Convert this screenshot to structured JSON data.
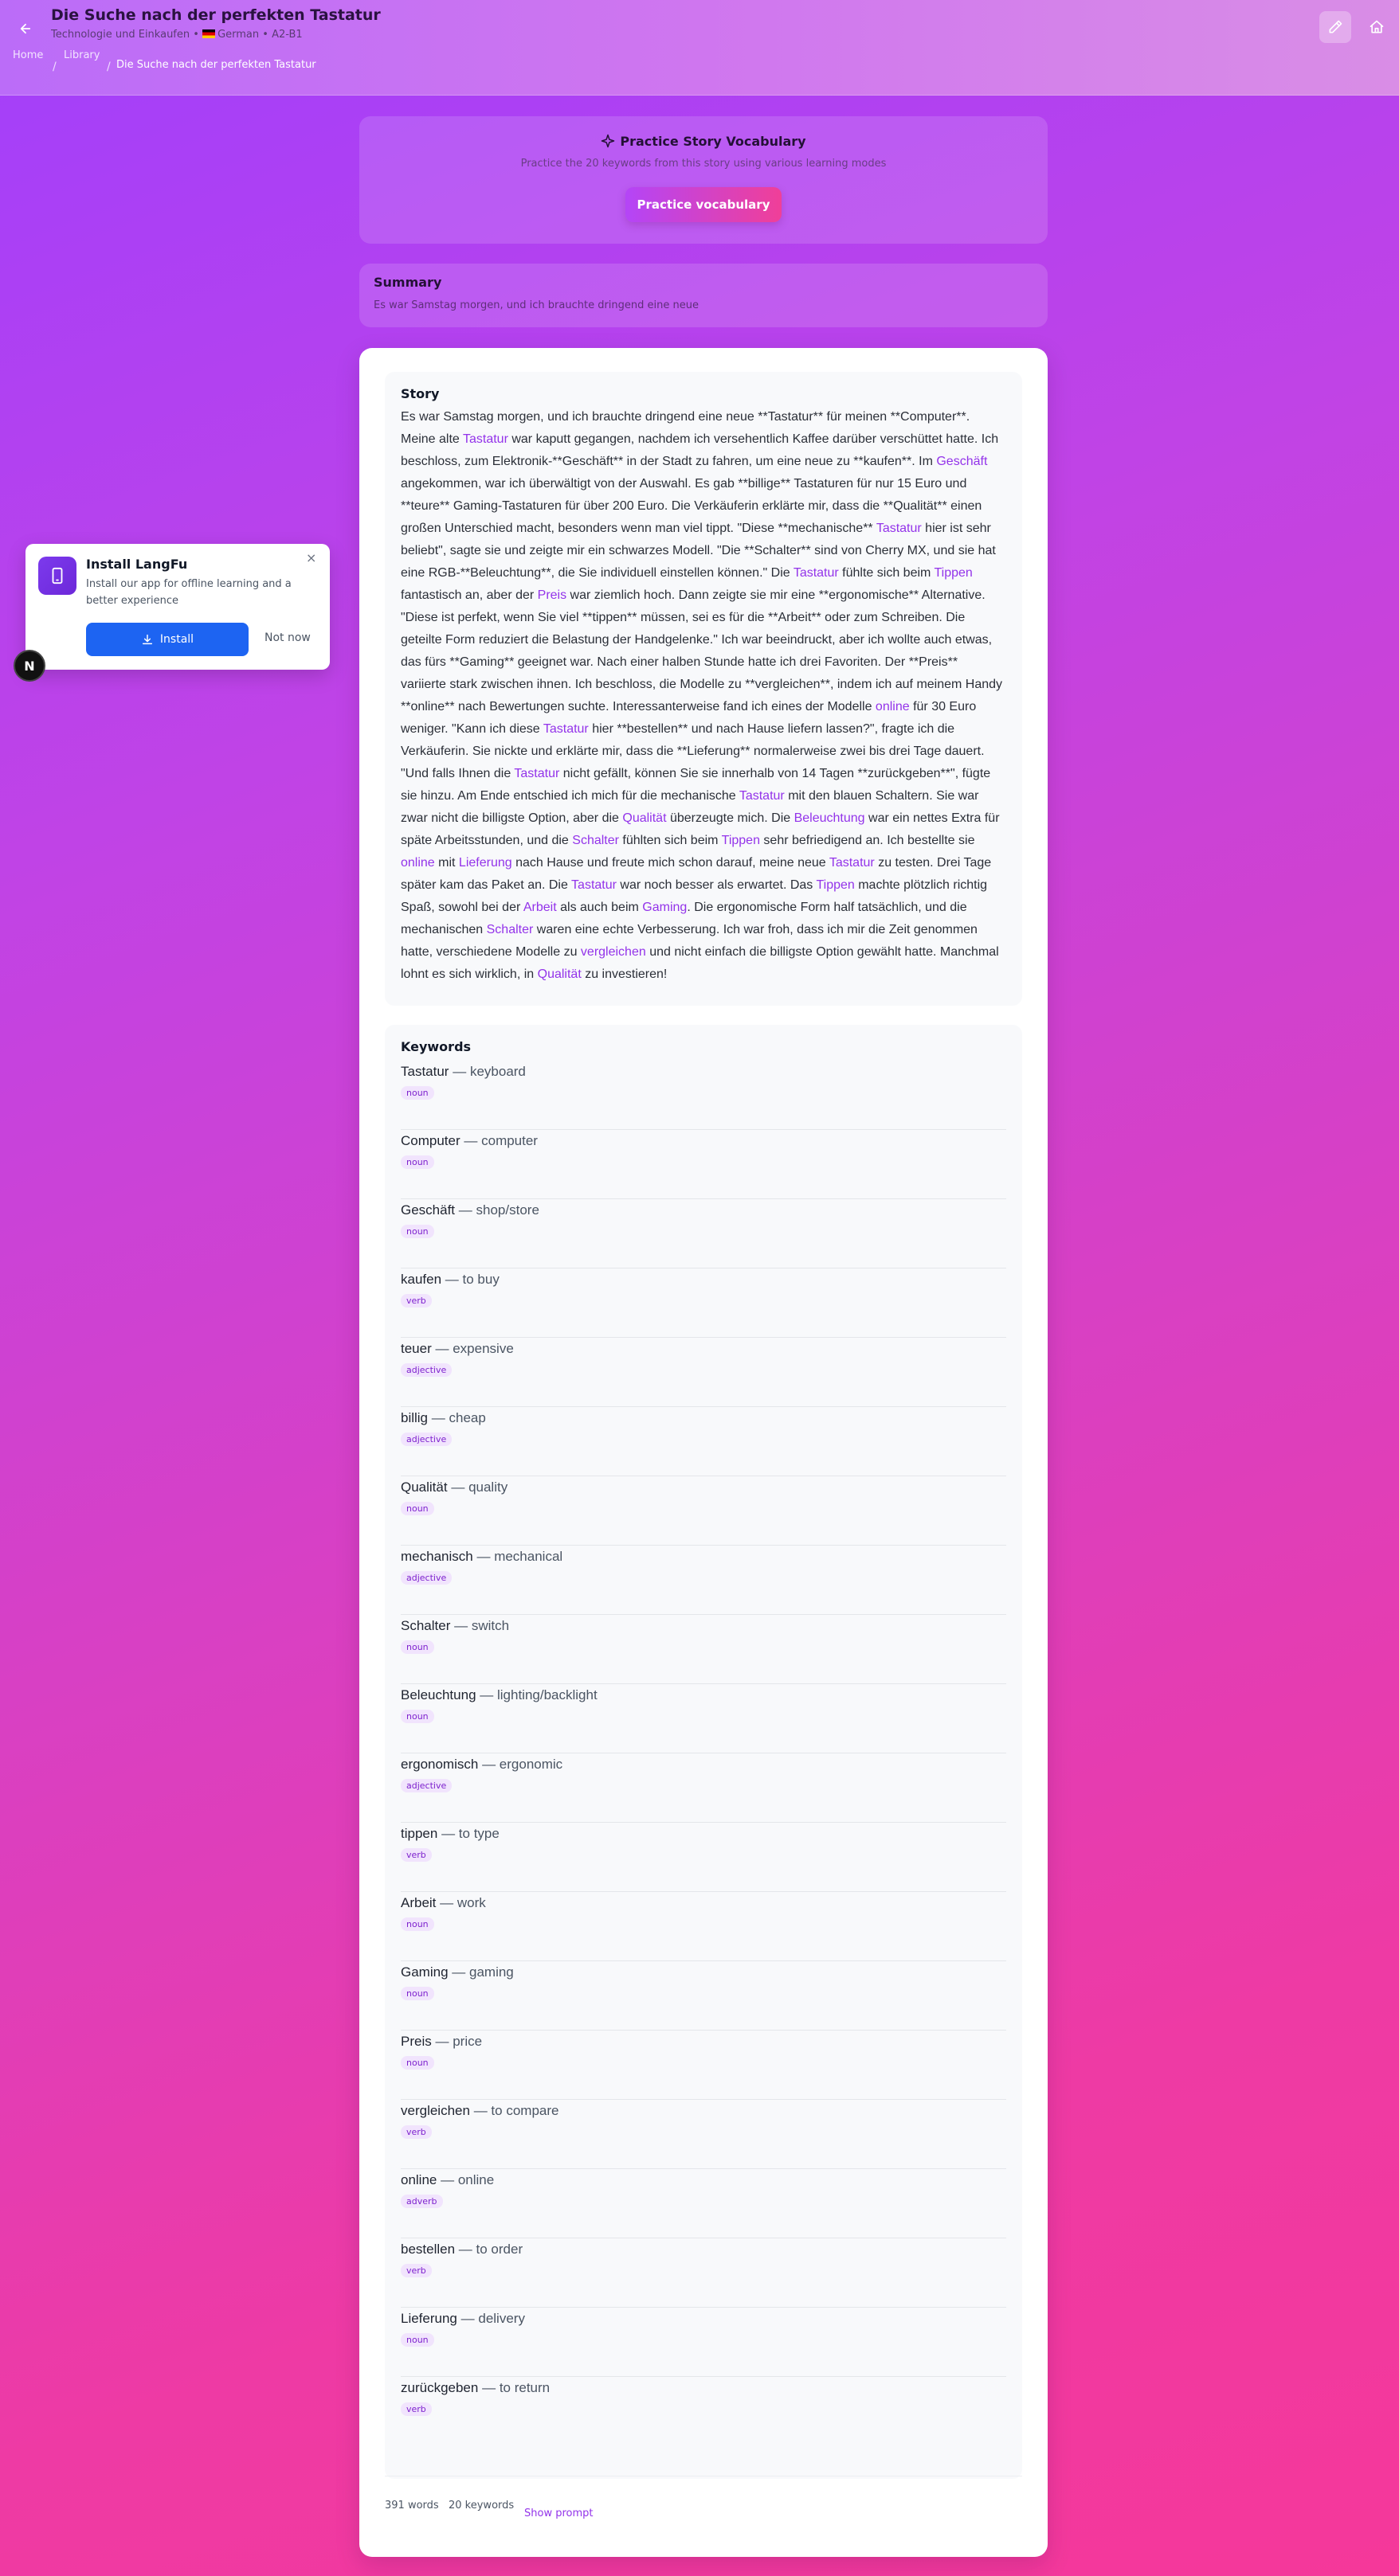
{
  "header": {
    "title": "Die Suche nach der perfekten Tastatur",
    "subtitle_category": "Technologie und Einkaufen",
    "subtitle_language": "German",
    "subtitle_level": "A2-B1",
    "subtitle_sep": "•",
    "breadcrumbs": [
      "Home",
      "Library",
      "Die Suche nach der perfekten Tastatur"
    ],
    "crumb_sep": "/"
  },
  "practice": {
    "title": "Practice Story Vocabulary",
    "description": "Practice the 20 keywords from this story using various learning modes",
    "button": "Practice vocabulary"
  },
  "summary": {
    "title": "Summary",
    "text": "Es war Samstag morgen, und ich brauchte dringend eine neue"
  },
  "story": {
    "title": "Story",
    "segments": [
      {
        "t": "Es war Samstag morgen, und ich brauchte dringend eine neue **Tastatur** für meinen **Computer**. Meine alte "
      },
      {
        "t": "Tastatur",
        "k": true
      },
      {
        "t": " war kaputt gegangen, nachdem ich versehentlich Kaffee darüber verschüttet hatte. Ich beschloss, zum Elektronik-**Geschäft** in der Stadt zu fahren, um eine neue zu **kaufen**. Im "
      },
      {
        "t": "Geschäft",
        "k": true
      },
      {
        "t": " angekommen, war ich überwältigt von der Auswahl. Es gab **billige** Tastaturen für nur 15 Euro und **teure** Gaming-Tastaturen für über 200 Euro. Die Verkäuferin erklärte mir, dass die **Qualität** einen großen Unterschied macht, besonders wenn man viel tippt. \"Diese **mechanische** "
      },
      {
        "t": "Tastatur",
        "k": true
      },
      {
        "t": " hier ist sehr beliebt\", sagte sie und zeigte mir ein schwarzes Modell. \"Die **Schalter** sind von Cherry MX, und sie hat eine RGB-**Beleuchtung**, die Sie individuell einstellen können.\" Die "
      },
      {
        "t": "Tastatur",
        "k": true
      },
      {
        "t": " fühlte sich beim "
      },
      {
        "t": "Tippen",
        "k": true
      },
      {
        "t": " fantastisch an, aber der "
      },
      {
        "t": "Preis",
        "k": true
      },
      {
        "t": " war ziemlich hoch. Dann zeigte sie mir eine **ergonomische** Alternative. \"Diese ist perfekt, wenn Sie viel **tippen** müssen, sei es für die **Arbeit** oder zum Schreiben. Die geteilte Form reduziert die Belastung der Handgelenke.\" Ich war beeindruckt, aber ich wollte auch etwas, das fürs **Gaming** geeignet war. Nach einer halben Stunde hatte ich drei Favoriten. Der **Preis** variierte stark zwischen ihnen. Ich beschloss, die Modelle zu **vergleichen**, indem ich auf meinem Handy **online** nach Bewertungen suchte. Interessanterweise fand ich eines der Modelle "
      },
      {
        "t": "online",
        "k": true
      },
      {
        "t": " für 30 Euro weniger. \"Kann ich diese "
      },
      {
        "t": "Tastatur",
        "k": true
      },
      {
        "t": " hier **bestellen** und nach Hause liefern lassen?\", fragte ich die Verkäuferin. Sie nickte und erklärte mir, dass die **Lieferung** normalerweise zwei bis drei Tage dauert. \"Und falls Ihnen die "
      },
      {
        "t": "Tastatur",
        "k": true
      },
      {
        "t": " nicht gefällt, können Sie sie innerhalb von 14 Tagen **zurückgeben**\", fügte sie hinzu. Am Ende entschied ich mich für die mechanische "
      },
      {
        "t": "Tastatur",
        "k": true
      },
      {
        "t": " mit den blauen Schaltern. Sie war zwar nicht die billigste Option, aber die "
      },
      {
        "t": "Qualität",
        "k": true
      },
      {
        "t": " überzeugte mich. Die "
      },
      {
        "t": "Beleuchtung",
        "k": true
      },
      {
        "t": " war ein nettes Extra für späte Arbeitsstunden, und die "
      },
      {
        "t": "Schalter",
        "k": true
      },
      {
        "t": " fühlten sich beim "
      },
      {
        "t": "Tippen",
        "k": true
      },
      {
        "t": " sehr befriedigend an. Ich bestellte sie "
      },
      {
        "t": "online",
        "k": true
      },
      {
        "t": " mit "
      },
      {
        "t": "Lieferung",
        "k": true
      },
      {
        "t": " nach Hause und freute mich schon darauf, meine neue "
      },
      {
        "t": "Tastatur",
        "k": true
      },
      {
        "t": " zu testen. Drei Tage später kam das Paket an. Die "
      },
      {
        "t": "Tastatur",
        "k": true
      },
      {
        "t": " war noch besser als erwartet. Das "
      },
      {
        "t": "Tippen",
        "k": true
      },
      {
        "t": " machte plötzlich richtig Spaß, sowohl bei der "
      },
      {
        "t": "Arbeit",
        "k": true
      },
      {
        "t": " als auch beim "
      },
      {
        "t": "Gaming",
        "k": true
      },
      {
        "t": ". Die ergonomische Form half tatsächlich, und die mechanischen "
      },
      {
        "t": "Schalter",
        "k": true
      },
      {
        "t": " waren eine echte Verbesserung. Ich war froh, dass ich mir die Zeit genommen hatte, verschiedene Modelle zu "
      },
      {
        "t": "vergleichen",
        "k": true
      },
      {
        "t": " und nicht einfach die billigste Option gewählt hatte. Manchmal lohnt es sich wirklich, in "
      },
      {
        "t": "Qualität",
        "k": true
      },
      {
        "t": " zu investieren!"
      }
    ]
  },
  "keywords": {
    "title": "Keywords",
    "dash": "—",
    "items": [
      {
        "word": "Tastatur",
        "translation": "keyboard",
        "pos": "noun"
      },
      {
        "word": "Computer",
        "translation": "computer",
        "pos": "noun"
      },
      {
        "word": "Geschäft",
        "translation": "shop/store",
        "pos": "noun"
      },
      {
        "word": "kaufen",
        "translation": "to buy",
        "pos": "verb"
      },
      {
        "word": "teuer",
        "translation": "expensive",
        "pos": "adjective"
      },
      {
        "word": "billig",
        "translation": "cheap",
        "pos": "adjective"
      },
      {
        "word": "Qualität",
        "translation": "quality",
        "pos": "noun"
      },
      {
        "word": "mechanisch",
        "translation": "mechanical",
        "pos": "adjective"
      },
      {
        "word": "Schalter",
        "translation": "switch",
        "pos": "noun"
      },
      {
        "word": "Beleuchtung",
        "translation": "lighting/backlight",
        "pos": "noun"
      },
      {
        "word": "ergonomisch",
        "translation": "ergonomic",
        "pos": "adjective"
      },
      {
        "word": "tippen",
        "translation": "to type",
        "pos": "verb"
      },
      {
        "word": "Arbeit",
        "translation": "work",
        "pos": "noun"
      },
      {
        "word": "Gaming",
        "translation": "gaming",
        "pos": "noun"
      },
      {
        "word": "Preis",
        "translation": "price",
        "pos": "noun"
      },
      {
        "word": "vergleichen",
        "translation": "to compare",
        "pos": "verb"
      },
      {
        "word": "online",
        "translation": "online",
        "pos": "adverb"
      },
      {
        "word": "bestellen",
        "translation": "to order",
        "pos": "verb"
      },
      {
        "word": "Lieferung",
        "translation": "delivery",
        "pos": "noun"
      },
      {
        "word": "zurückgeben",
        "translation": "to return",
        "pos": "verb"
      }
    ]
  },
  "footer": {
    "word_count": "391 words",
    "keyword_count": "20 keywords",
    "show_prompt": "Show prompt"
  },
  "install_popup": {
    "title": "Install LangFu",
    "description": "Install our app for offline learning and a better experience",
    "install_button": "Install",
    "dismiss": "Not now",
    "close_glyph": "×"
  },
  "dev_badge": {
    "letter": "N"
  },
  "colors": {
    "accent": "#9333ea",
    "install_button": "#1d64f2",
    "gradient_start": "#a23ffb",
    "gradient_end": "#f5389a"
  }
}
